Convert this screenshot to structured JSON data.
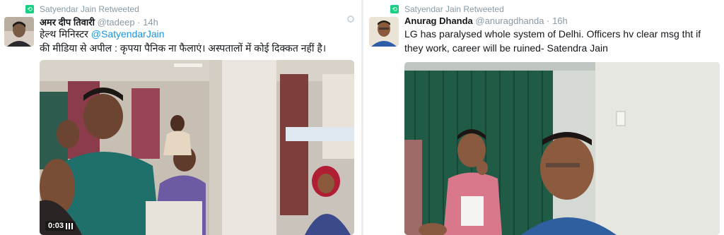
{
  "left_tweet": {
    "retweeted_by": "Satyendar Jain Retweeted",
    "author_name": "अमर दीप तिवारी",
    "author_handle": "@tadeep",
    "separator": "·",
    "time": "14h",
    "text_before_mention": "हेल्थ मिनिस्टर ",
    "mention": "@SatyendarJain",
    "text_line2": "की मीडिया से अपील : कृपया पैनिक ना फैलाएं। अस्पतालों में कोई दिक्कत नहीं है।",
    "video_duration": "0:03"
  },
  "right_tweet": {
    "retweeted_by": "Satyendar Jain Retweeted",
    "author_name": "Anurag Dhanda",
    "author_handle": "@anuragdhanda",
    "separator": "·",
    "time": "16h",
    "text": "LG has paralysed whole system of Delhi. Officers hv clear msg tht if they work, career will be ruined- Satendra Jain"
  },
  "icons": {
    "retweet": "retweet-icon",
    "settings": "gear-icon",
    "video_bars": "signal-bars-icon"
  },
  "colors": {
    "retweet_green": "#19cf86",
    "mention_blue": "#1b95e0",
    "meta_gray": "#8899a6",
    "text_dark": "#14171a"
  }
}
